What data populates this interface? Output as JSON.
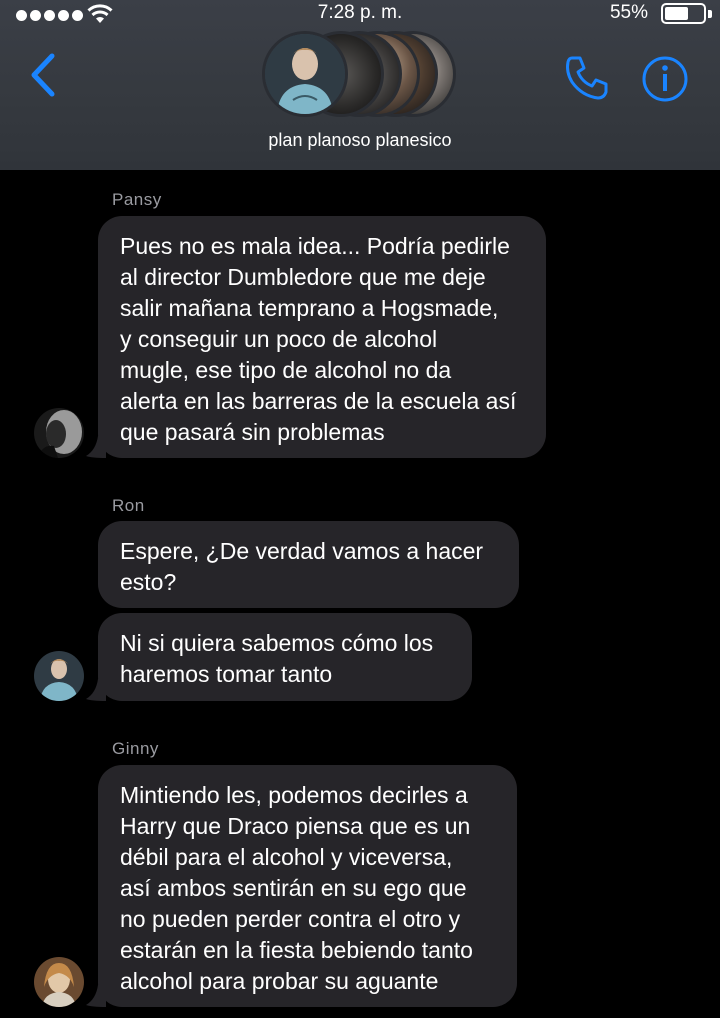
{
  "status_bar": {
    "time": "7:28 p. m.",
    "battery_percent": "55%",
    "battery_level": 0.55
  },
  "header": {
    "group_name": "plan planoso planesico",
    "back_icon": "chevron-left-icon",
    "call_icon": "phone-icon",
    "info_icon": "info-icon",
    "accent": "#1a84ff"
  },
  "messages": [
    {
      "sender": "Pansy",
      "lines": [
        "Pues no es mala idea... Podría pedirle",
        "al director Dumbledore que me deje",
        "salir mañana temprano a Hogsmade,",
        "y conseguir un poco de alcohol",
        "mugle, ese tipo de alcohol no da",
        "alerta en las barreras de la escuela así",
        "que pasará sin problemas"
      ]
    },
    {
      "sender": "Ron",
      "bubbles": [
        {
          "lines": [
            "Espere, ¿De verdad vamos a hacer",
            "esto?"
          ]
        },
        {
          "lines": [
            "Ni si quiera sabemos cómo los",
            "haremos tomar tanto"
          ]
        }
      ]
    },
    {
      "sender": "Ginny",
      "lines": [
        "Mintiendo les, podemos decirles a",
        "Harry que Draco piensa que es un",
        "débil para el alcohol y viceversa,",
        "así ambos sentirán en su ego que",
        "no pueden perder contra el otro y",
        "estarán en la fiesta bebiendo tanto",
        "alcohol para probar su aguante"
      ]
    }
  ],
  "colors": {
    "bubble": "#262529",
    "background": "#000000",
    "sender_label": "#9a9ba1"
  }
}
